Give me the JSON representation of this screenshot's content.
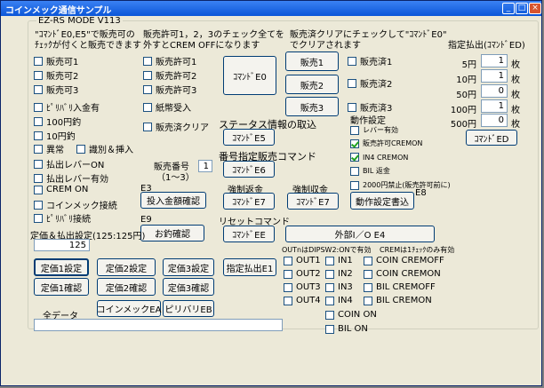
{
  "window": {
    "title": "コインメック通信サンプル",
    "mode_label": "EZ-RS MODE V113"
  },
  "notes": {
    "e0e5_line1": "\"ｺﾏﾝﾄﾞE0,E5\"で販売可の",
    "e0e5_line2": "ﾁｪｯｸが付くと販売できます",
    "permit_line1": "販売許可1，2，3のチェック全てを",
    "permit_line2": "外すとCREM  OFFになります",
    "sold_line1": "販売済クリアにチェックして\"ｺﾏﾝﾄﾞE0\"",
    "sold_line2": "でクリアされます"
  },
  "sellable": [
    "販売可1",
    "販売可2",
    "販売可3"
  ],
  "status": [
    "ﾋﾟﾘﾊﾞﾘ入金有",
    "100円釣",
    "10円釣",
    "異常",
    "払出レバーON",
    "払出レバー有効",
    "CREM ON",
    "コインメック接続",
    "ﾋﾟﾘﾊﾞﾘ接続"
  ],
  "insert_detect": "識別＆挿入",
  "permit": [
    "販売許可1",
    "販売許可2",
    "販売許可3"
  ],
  "bill_accept": "紙幣受入",
  "sold_clear": "販売済クリア",
  "sold": [
    "販売済1",
    "販売済2",
    "販売済3"
  ],
  "sale_buttons": [
    "販売1",
    "販売2",
    "販売3"
  ],
  "labels": {
    "status_read": "ステータス情報の取込",
    "sale_no_line1": "販売番号",
    "sale_no_line2": "（1～3）",
    "sale_no_value": "1",
    "num_sale_cmd": "番号指定販売コマンド",
    "force_return": "強制返金",
    "force_collect": "強制収金",
    "e3": "E3",
    "e9": "E9",
    "e8": "E8",
    "reset_cmd": "リセットコマンド",
    "price_setting": "定価＆払出設定(125:125円)",
    "price_value": "125",
    "outn_note": "OUTnはDIPSW2:ONで有効",
    "crem_note": "CREMは1ﾁｪｯｸのみ有効",
    "all_data": "全データ",
    "payout_title": "指定払出(ｺﾏﾝﾄﾞED)",
    "op_settings": "動作設定",
    "unit": "枚"
  },
  "commands": {
    "e0": "ｺﾏﾝﾄﾞE0",
    "e5": "ｺﾏﾝﾄﾞE5",
    "e6": "ｺﾏﾝﾄﾞE6",
    "e7a": "ｺﾏﾝﾄﾞE7",
    "e7b": "ｺﾏﾝﾄﾞE7",
    "ee": "ｺﾏﾝﾄﾞEE",
    "ed": "ｺﾏﾝﾄﾞED",
    "amount_confirm": "投入金額確認",
    "change_confirm": "お釣確認",
    "op_write": "動作設定書込",
    "external_io": "外部I／O E4",
    "payout_e1": "指定払出E1",
    "coinmech_ea": "コインメックEA",
    "piribari_eb": "ピリバリEB"
  },
  "price_buttons": {
    "set": [
      "定価1設定",
      "定価2設定",
      "定価3設定"
    ],
    "confirm": [
      "定価1確認",
      "定価2確認",
      "定価3確認"
    ]
  },
  "op_options": [
    {
      "label": "レバー有効",
      "checked": false
    },
    {
      "label": "販売許可CREMON",
      "checked": true
    },
    {
      "label": "IN4 CREMON",
      "checked": true
    },
    {
      "label": "BIL 返金",
      "checked": false
    },
    {
      "label": "2000円禁止(販売許可前に)",
      "checked": false
    }
  ],
  "payout": [
    {
      "denom": "5円",
      "count": "1"
    },
    {
      "denom": "10円",
      "count": "1"
    },
    {
      "denom": "50円",
      "count": "0"
    },
    {
      "denom": "100円",
      "count": "1"
    },
    {
      "denom": "500円",
      "count": "0"
    }
  ],
  "outs": [
    "OUT1",
    "OUT2",
    "OUT3",
    "OUT4"
  ],
  "ins": [
    "IN1",
    "IN2",
    "IN3",
    "IN4"
  ],
  "crem": [
    "COIN CREMOFF",
    "COIN CREMON",
    "BIL CREMOFF",
    "BIL CREMON"
  ],
  "coin_on": "COIN ON",
  "bil_on": "BIL   ON",
  "all_data_value": ""
}
